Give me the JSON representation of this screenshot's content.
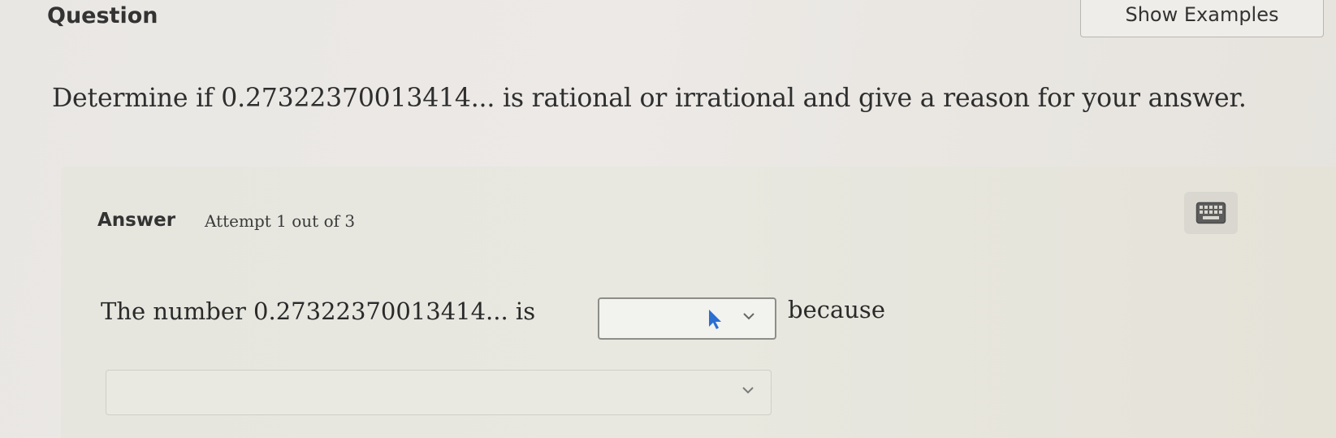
{
  "header": {
    "title": "Question",
    "show_examples_label": "Show Examples"
  },
  "question": {
    "text": "Determine if 0.27322370013414... is rational or irrational and give a reason for your answer."
  },
  "answer": {
    "label": "Answer",
    "attempt": "Attempt 1 out of 3",
    "sentence_start": "The number 0.27322370013414... is",
    "choice_value": "",
    "sentence_end": "because",
    "reason_value": ""
  },
  "icons": {
    "keyboard": "keyboard-icon",
    "cursor": "mouse-pointer-icon",
    "chevron": "chevron-down-icon"
  },
  "colors": {
    "background": "#ebe8e5",
    "panel": "#e7e7df",
    "cursor": "#2a6fd1"
  }
}
